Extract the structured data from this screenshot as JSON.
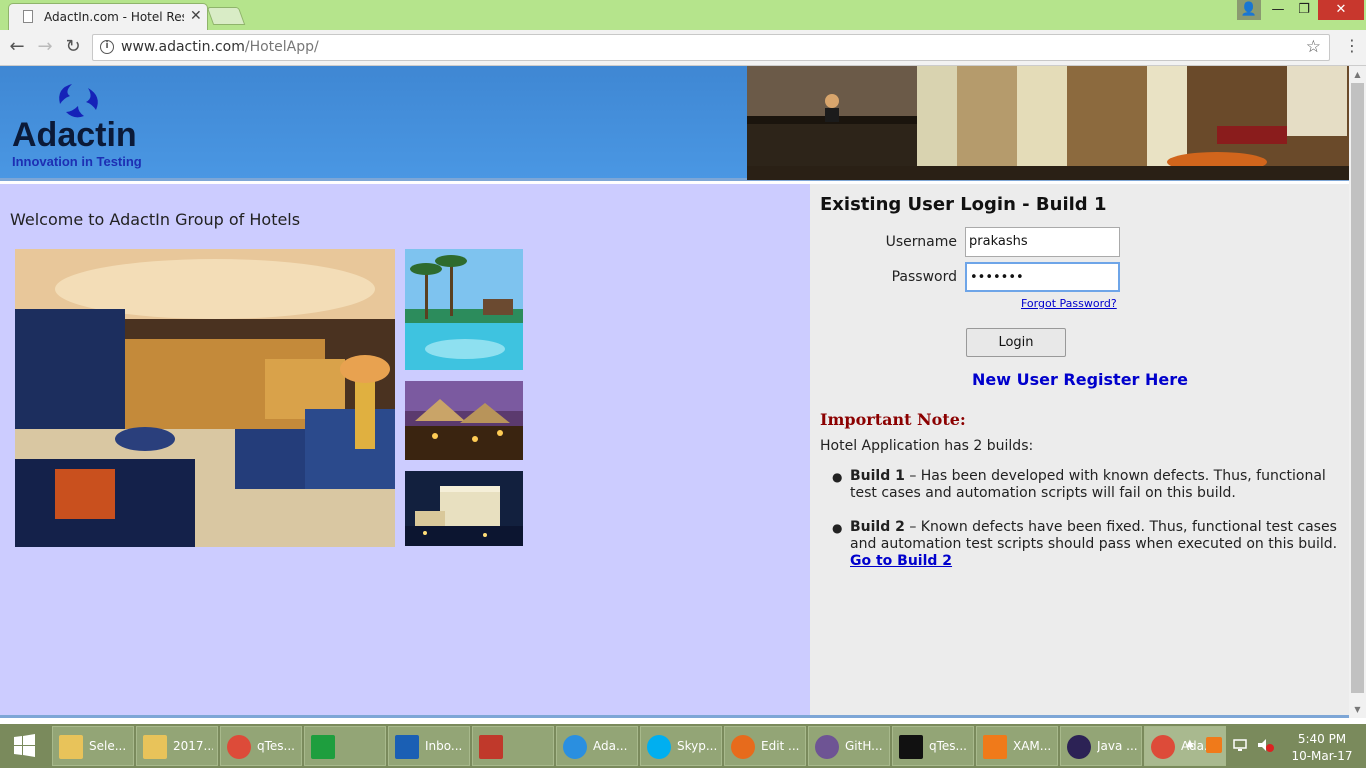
{
  "browser": {
    "tab_title": "AdactIn.com - Hotel Rese",
    "tab_close": "✕",
    "url_host": "www.adactin.com",
    "url_path": "/HotelApp/",
    "window_controls": {
      "minimize": "—",
      "maximize": "❐",
      "close": "✕"
    }
  },
  "header": {
    "logo_text": "Adactin",
    "logo_tagline": "Innovation in Testing"
  },
  "left": {
    "welcome": "Welcome to AdactIn Group of Hotels"
  },
  "login": {
    "title": "Existing User Login - Build 1",
    "username_label": "Username",
    "username_value": "prakashs",
    "password_label": "Password",
    "password_value": "•••••••",
    "forgot_link": "Forgot Password?",
    "login_button": "Login",
    "register_link": "New User Register Here"
  },
  "note": {
    "title": "Important Note:",
    "intro": "Hotel Application has 2 builds:",
    "build1_name": "Build 1",
    "build1_text": " – Has been developed with known defects. Thus, functional test cases and automation scripts will fail on this build.",
    "build2_name": "Build 2",
    "build2_text": " – Known defects have been fixed. Thus, functional test cases and automation test scripts should pass when executed on this build.",
    "build2_link": "Go to Build 2"
  },
  "taskbar": {
    "items": [
      {
        "label": "Sele...",
        "icon": "folder-icon"
      },
      {
        "label": "2017...",
        "icon": "folder-icon"
      },
      {
        "label": "qTes...",
        "icon": "chrome-icon"
      },
      {
        "label": "",
        "icon": "store-icon"
      },
      {
        "label": "Inbo...",
        "icon": "outlook-icon"
      },
      {
        "label": "",
        "icon": "ccleaner-icon"
      },
      {
        "label": "Ada...",
        "icon": "ie-icon"
      },
      {
        "label": "Skyp...",
        "icon": "skype-icon"
      },
      {
        "label": "Edit ...",
        "icon": "firefox-icon"
      },
      {
        "label": "GitH...",
        "icon": "github-icon"
      },
      {
        "label": "qTes...",
        "icon": "cmd-icon"
      },
      {
        "label": "XAM...",
        "icon": "xampp-icon"
      },
      {
        "label": "Java ...",
        "icon": "eclipse-icon"
      },
      {
        "label": "Ada...",
        "icon": "chrome-icon"
      }
    ],
    "clock_time": "5:40 PM",
    "clock_date": "10-Mar-17"
  }
}
